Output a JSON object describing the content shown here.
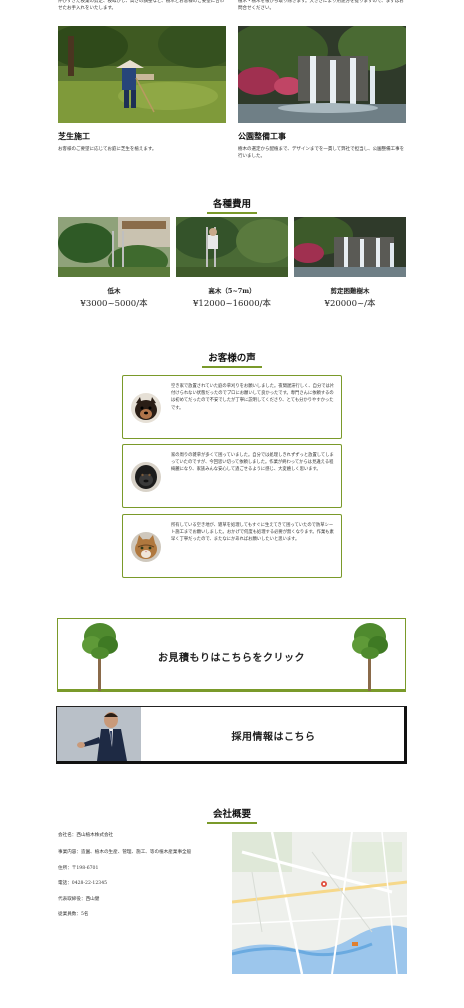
{
  "top": {
    "left_text": "伸びすぎた枝葉の剪定、枝ぬかし、高さの調整など、樹木とお客様のご要望に合わせたお手入れをいたします。",
    "right_text": "植木・樹木を根から取り除きます。大きさにより用途方を提りますので、まずはお問合せください。"
  },
  "services": [
    {
      "title": "芝生施工",
      "desc": "お客様のご要望に応じてお庭に芝生を植えます。"
    },
    {
      "title": "公園整備工事",
      "desc": "樹木の選定から配植まで、デザインまでを一貫して弊社で担当し、公園整備工事を行いました。"
    }
  ],
  "costs": {
    "heading": "各種費用",
    "items": [
      {
        "label": "低木",
        "price": "¥3000~5000/本"
      },
      {
        "label": "高木（5~7m）",
        "price": "¥12000~16000/本"
      },
      {
        "label": "剪定困難樹木",
        "price": "¥20000~/本"
      }
    ]
  },
  "voices": {
    "heading": "お客様の声",
    "items": [
      {
        "avatar": "dog-avatar",
        "text": "空き家で放置されていた庭の草刈りをお願いしました。夜間遅滞行しく、自分では片付けられない状態だったのでプロにお願いして良かったです。専門さんに依頼するのは初めてだったので不安でしたが丁寧に説明してくださり、とても分かりやすかったです。"
      },
      {
        "avatar": "gorilla-avatar",
        "text": "家の周りの雑草が多くて困っていました。自分では処理しきれずずっと放置してしまっていたのですが、今回思い切って依頼しました。作業が終わってからは見違える程綺麗になり、家族みんな安心して過ごせるように感じ、大変嬉しく思います。"
      },
      {
        "avatar": "cat-avatar",
        "text": "所有している空き地が、雑草を処理してもすぐに生えてきて困っていたので防草シート施工までお願いしました。おかげで何度も処理する必要が無くなります。作業も素早く丁寧だったので、またなにかあればお願いしたいと思います。"
      }
    ]
  },
  "cta": {
    "estimate_label": "お見積もりはこちらをクリック",
    "recruit_label": "採用情報はこちら"
  },
  "company": {
    "heading": "会社概要",
    "rows": [
      "会社名：西山植木株式会社",
      "事業内容：造園、植木の生産、管理、施工、等の植木産業事全般",
      "住所：〒198-6701",
      "電話：0428-22-12345",
      "代表取締役：西山健",
      "従業員数：5名"
    ]
  },
  "colors": {
    "accent": "#7a9a2a",
    "text": "#222222"
  }
}
